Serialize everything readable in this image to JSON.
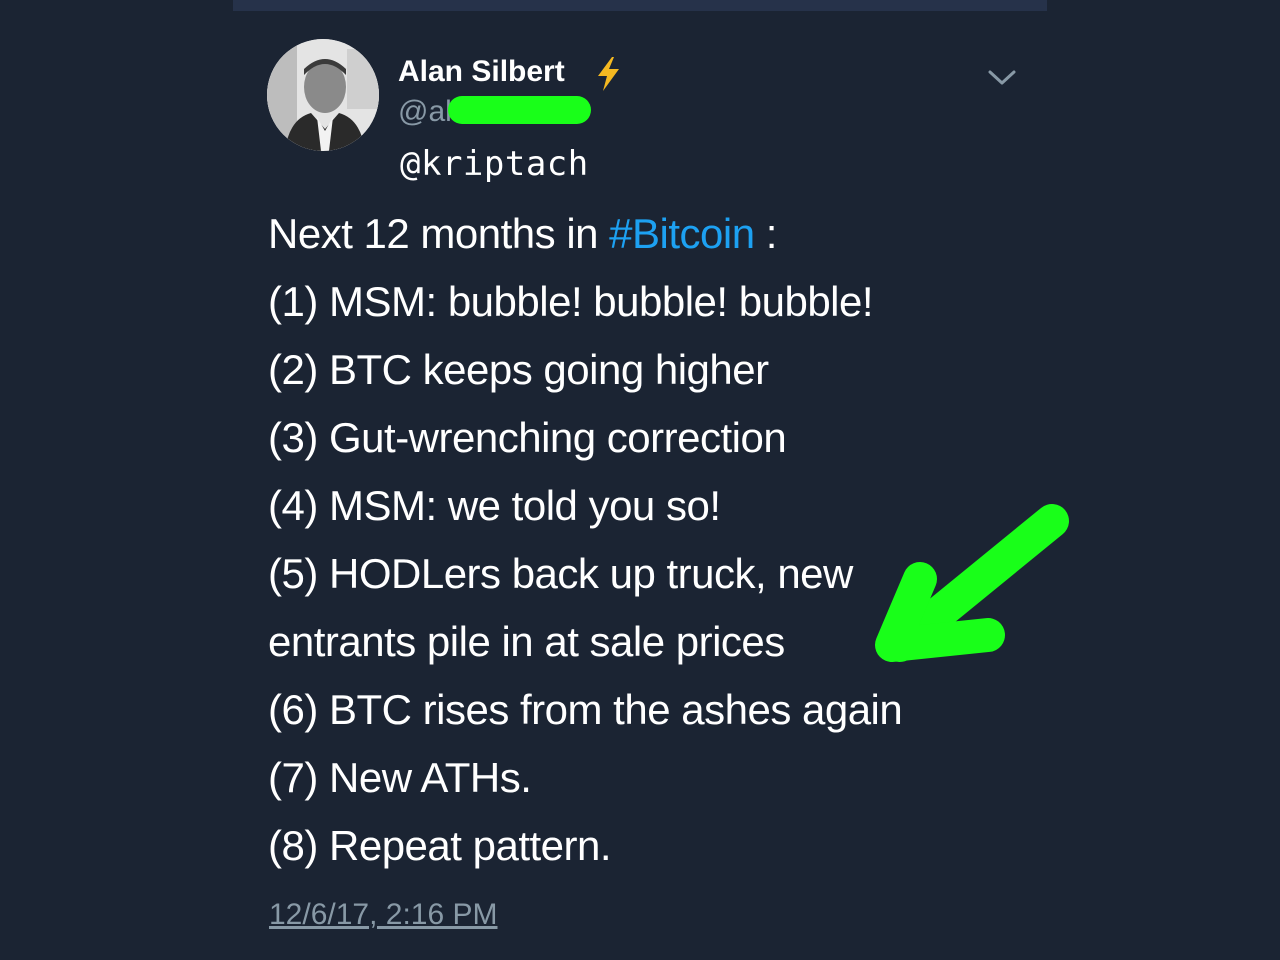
{
  "tweet": {
    "author_name": "Alan Silbert",
    "handle_visible": "@al",
    "watermark": "@kriptach",
    "lines": [
      {
        "before": "Next 12 months in ",
        "hashtag": "#Bitcoin",
        "after": " :"
      },
      {
        "text": "(1) MSM: bubble! bubble! bubble!"
      },
      {
        "text": "(2) BTC keeps going higher"
      },
      {
        "text": "(3) Gut-wrenching correction"
      },
      {
        "text": "(4) MSM: we told you so!"
      },
      {
        "text": "(5) HODLers back up truck, new"
      },
      {
        "text": "entrants pile in at sale prices"
      },
      {
        "text": "(6) BTC rises from the ashes again"
      },
      {
        "text": "(7) New ATHs."
      },
      {
        "text": "(8) Repeat pattern."
      }
    ],
    "timestamp": "12/6/17, 2:16 PM"
  },
  "icons": {
    "verified": "lightning-bolt-icon",
    "menu": "chevron-down-icon",
    "annotation": "green-arrow"
  },
  "colors": {
    "background": "#1b2433",
    "text": "#ffffff",
    "muted": "#8899a6",
    "hashtag": "#1da1f2",
    "bolt": "#f5b921",
    "highlight": "#19ff19"
  }
}
